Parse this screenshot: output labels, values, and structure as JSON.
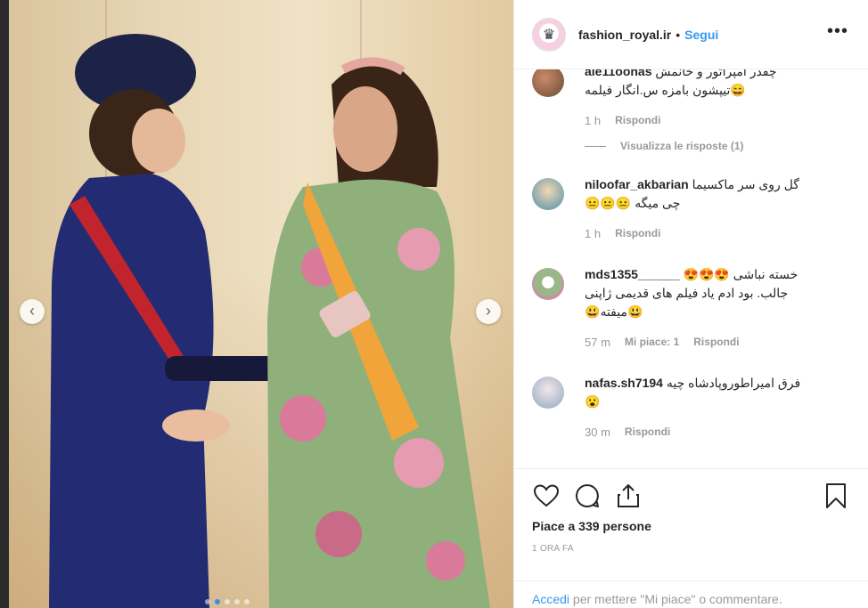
{
  "post": {
    "username": "fashion_royal.ir",
    "separator": "•",
    "follow_label": "Segui",
    "more_icon": "•••",
    "prev_arrow": "‹",
    "next_arrow": "›"
  },
  "comments": [
    {
      "username": "ale11oonas",
      "text_line1": "چقدر امپراتور و خانمش",
      "text_line2": "تیپشون بامزه س.انگار فیلمه😄",
      "time": "1 h",
      "likes": "",
      "reply_label": "Rispondi",
      "view_replies": "Visualizza le risposte (1)"
    },
    {
      "username": "niloofar_akbarian",
      "text_line1": "گل روی سر ماکسیما",
      "text_line2": "😐😐😐 چی میگه",
      "time": "1 h",
      "likes": "",
      "reply_label": "Rispondi"
    },
    {
      "username": "mds1355______",
      "text_line1": "😍😍😍 خسته نباشی",
      "text_line2": "جالب. بود ادم یاد فیلم های قدیمی ژاپنی",
      "text_line3": "😃میفته😃",
      "time": "57 m",
      "likes": "Mi piace: 1",
      "reply_label": "Rispondi"
    },
    {
      "username": "nafas.sh7194",
      "text_line1": "فرق امیراطوروپادشاه چیه",
      "text_line2": "😮",
      "time": "30 m",
      "likes": "",
      "reply_label": "Rispondi"
    }
  ],
  "actions": {
    "likes_text": "Piace a 339 persone",
    "timestamp": "1 ORA FA"
  },
  "login": {
    "link_text": "Accedi",
    "rest_text": " per mettere \"Mi piace\" o commentare."
  },
  "colors": {
    "accent": "#3897f0",
    "text": "#262626",
    "muted": "#999999"
  }
}
